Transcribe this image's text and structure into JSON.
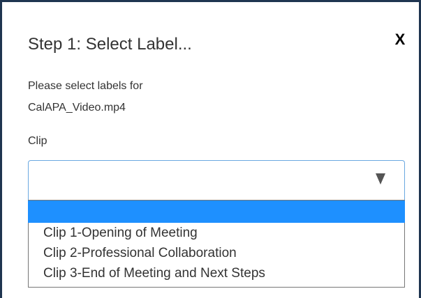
{
  "dialog": {
    "title": "Step 1: Select Label...",
    "close_label": "X",
    "description_lines": [
      "Please select labels for",
      "CalAPA_Video.mp4"
    ]
  },
  "clip_field": {
    "label": "Clip",
    "selected_value": "",
    "options": [
      "",
      "Clip 1-Opening of Meeting",
      "Clip 2-Professional Collaboration",
      "Clip 3-End of Meeting and Next Steps"
    ],
    "highlighted_index": 0
  },
  "colors": {
    "frame_border": "#1f3550",
    "select_focus_border": "#6aa8e0",
    "option_highlight": "#1e90ff",
    "text": "#333333"
  },
  "icons": {
    "close": "close-icon",
    "caret": "triangle-down-icon"
  }
}
